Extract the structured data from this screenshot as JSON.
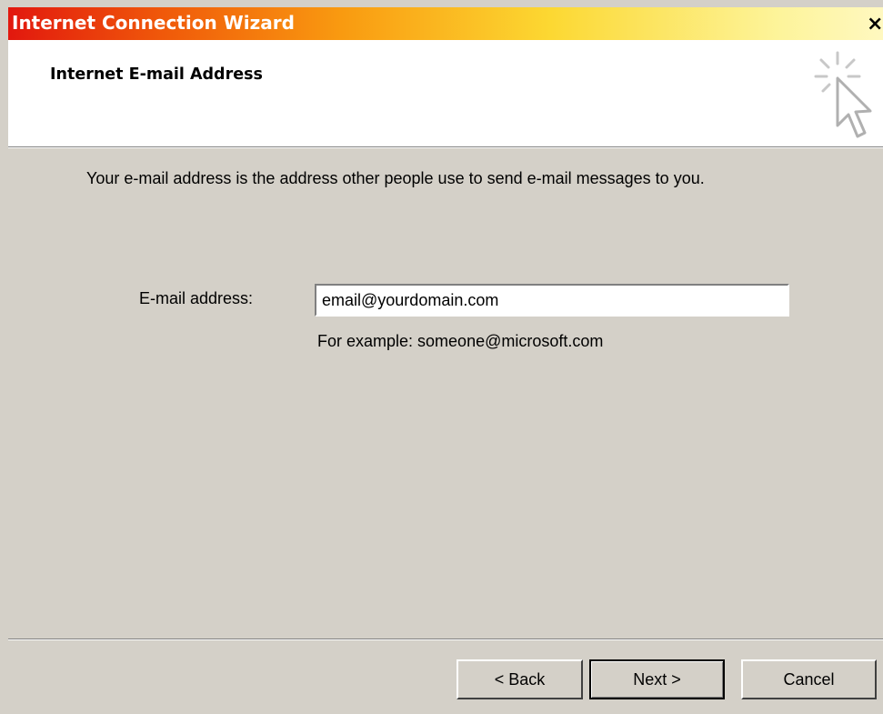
{
  "window": {
    "title": "Internet Connection Wizard",
    "close_glyph": "×"
  },
  "header": {
    "title": "Internet E-mail Address",
    "icon": "wizard-cursor-sparkle-icon"
  },
  "body": {
    "description": "Your e-mail address is the address other people use to send e-mail messages to you.",
    "email_label": "E-mail address:",
    "email_value": "email@yourdomain.com",
    "example": "For example: someone@microsoft.com"
  },
  "buttons": {
    "back": "< Back",
    "next": "Next >",
    "cancel": "Cancel"
  },
  "colors": {
    "title_gradient_start": "#e2180e",
    "title_gradient_end": "#fff8c0",
    "dialog_face": "#d4d0c8"
  }
}
